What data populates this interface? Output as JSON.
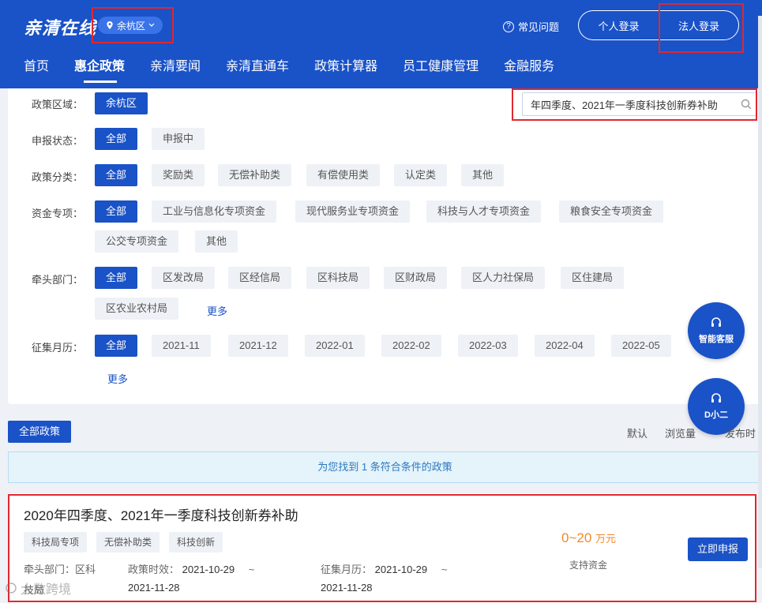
{
  "header": {
    "logo": "亲清在线",
    "region": "余杭区",
    "faq": "常见问题",
    "login_personal": "个人登录",
    "login_legal": "法人登录"
  },
  "nav": {
    "items": [
      "首页",
      "惠企政策",
      "亲清要闻",
      "亲清直通车",
      "政策计算器",
      "员工健康管理",
      "金融服务"
    ],
    "active": "惠企政策"
  },
  "search": {
    "value": "年四季度、2021年一季度科技创新券补助"
  },
  "filters": {
    "region": {
      "label": "政策区域：",
      "options": [
        "余杭区"
      ]
    },
    "status": {
      "label": "申报状态：",
      "options": [
        "全部",
        "申报中"
      ]
    },
    "category": {
      "label": "政策分类：",
      "options": [
        "全部",
        "奖励类",
        "无偿补助类",
        "有偿使用类",
        "认定类",
        "其他"
      ]
    },
    "fund": {
      "label": "资金专项：",
      "options": [
        "全部",
        "工业与信息化专项资金",
        "现代服务业专项资金",
        "科技与人才专项资金",
        "粮食安全专项资金",
        "公交专项资金",
        "其他"
      ]
    },
    "dept": {
      "label": "牵头部门：",
      "options": [
        "全部",
        "区发改局",
        "区经信局",
        "区科技局",
        "区财政局",
        "区人力社保局",
        "区住建局",
        "区农业农村局"
      ],
      "more": "更多"
    },
    "month": {
      "label": "征集月历：",
      "options": [
        "全部",
        "2021-11",
        "2021-12",
        "2022-01",
        "2022-02",
        "2022-03",
        "2022-04",
        "2022-05"
      ],
      "more": "更多"
    }
  },
  "floating": {
    "service": "智能客服",
    "assistant": "D小二"
  },
  "results": {
    "all_label": "全部政策",
    "sort": [
      "默认",
      "浏览量",
      "发布时"
    ],
    "summary": "为您找到 1 条符合条件的政策"
  },
  "policy": {
    "title": "2020年四季度、2021年一季度科技创新券补助",
    "tags": [
      "科技局专项",
      "无偿补助类",
      "科技创新"
    ],
    "dept_label": "牵头部门：",
    "dept_value": "区科技局",
    "dept_line1": "牵头部门：区科",
    "dept_line2": "技局",
    "validity_label": "政策时效：",
    "validity_start": "2021-10-29",
    "validity_sep": "~",
    "validity_end": "2021-11-28",
    "collect_label": "征集月历：",
    "collect_start": "2021-10-29",
    "collect_sep": "~",
    "collect_end": "2021-11-28",
    "amount": "0~20",
    "amount_unit": "万元",
    "amount_label": "支持资金",
    "apply": "立即申报"
  },
  "watermark": "大数跨境",
  "colors": {
    "brand": "#1a52c7",
    "accent": "#f0892a",
    "highlight": "#e0282e"
  }
}
